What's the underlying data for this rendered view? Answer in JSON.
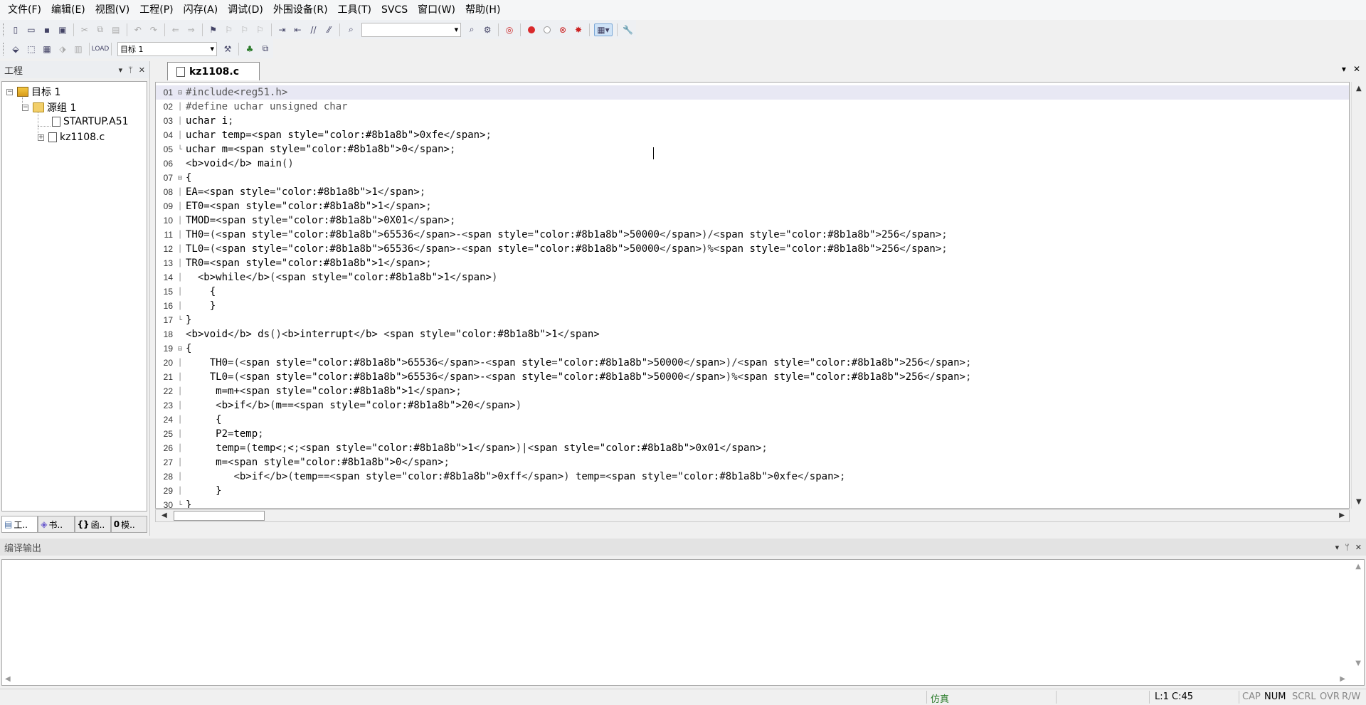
{
  "menu": [
    "文件(F)",
    "编辑(E)",
    "视图(V)",
    "工程(P)",
    "闪存(A)",
    "调试(D)",
    "外围设备(R)",
    "工具(T)",
    "SVCS",
    "窗口(W)",
    "帮助(H)"
  ],
  "toolbar": {
    "target_select": "目标 1"
  },
  "project": {
    "title": "工程",
    "target": "目标 1",
    "group": "源组 1",
    "files": [
      "STARTUP.A51",
      "kz1108.c"
    ],
    "tabs": [
      "工..",
      "书..",
      "函..",
      "模.."
    ]
  },
  "editor": {
    "tab": "kz1108.c",
    "lines": [
      "#include<reg51.h>",
      "#define uchar unsigned char",
      "uchar i;",
      "uchar temp=0xfe;",
      "uchar m=0;",
      "void main()",
      "{",
      "EA=1;",
      "ET0=1;",
      "TMOD=0X01;",
      "TH0=(65536-50000)/256;",
      "TL0=(65536-50000)%256;",
      "TR0=1;",
      "  while(1)",
      "    {",
      "    }",
      "}",
      "void ds()interrupt 1",
      "{",
      "    TH0=(65536-50000)/256;",
      "    TL0=(65536-50000)%256;",
      "     m=m+1;",
      "     if(m==20)",
      "     {",
      "     P2=temp;",
      "     temp=(temp<<1)|0x01;",
      "     m=0;",
      "        if(temp==0xff) temp=0xfe;",
      "     }",
      "}"
    ]
  },
  "output": {
    "title": "编译输出"
  },
  "status": {
    "mode": "仿真",
    "position": "L:1 C:45",
    "cap": "CAP",
    "num": "NUM",
    "scrl": "SCRL",
    "ovr": "OVR",
    "rw": "R/W"
  }
}
